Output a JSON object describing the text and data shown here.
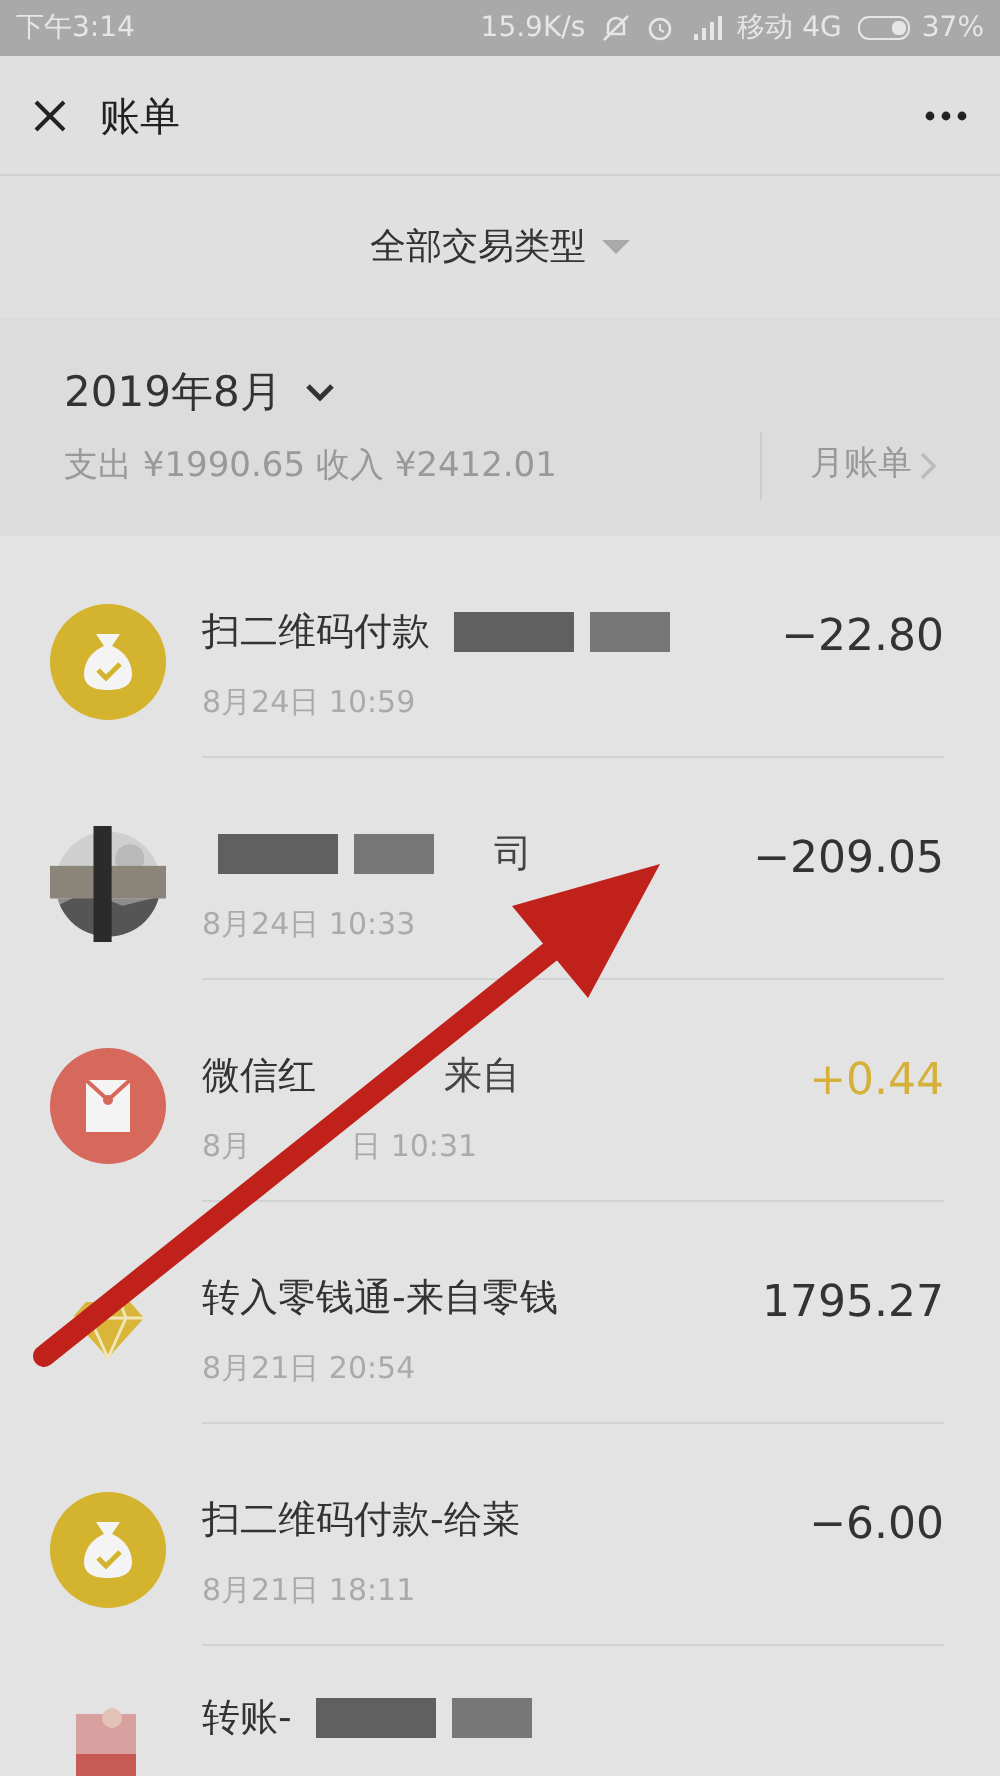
{
  "status_bar": {
    "time": "下午3:14",
    "speed": "15.9K/s",
    "carrier": "移动 4G",
    "battery": "37%"
  },
  "header": {
    "title": "账单"
  },
  "filter": {
    "label": "全部交易类型"
  },
  "month": {
    "title": "2019年8月",
    "summary": "支出 ¥1990.65 收入 ¥2412.01",
    "link": "月账单"
  },
  "transactions": [
    {
      "kind": "bag",
      "title": "扫二维码付款",
      "redacted": true,
      "date": [
        "8月24日 10:59"
      ],
      "amount": "−22.80",
      "income": false
    },
    {
      "title_end": "司",
      "redacted": true,
      "date": [
        "8月24日 10:33"
      ],
      "amount": "−209.05",
      "income": false
    },
    {
      "kind": "envelope",
      "title": "微信红",
      "title_end": "来自",
      "redacted": false,
      "date": [
        "8月",
        "日 10:31"
      ],
      "amount": "+0.44",
      "income": true
    },
    {
      "kind": "diamond",
      "title": "转入零钱通-来自零钱",
      "redacted": false,
      "date": [
        "8月21日 20:54"
      ],
      "amount": "1795.27",
      "income": false
    },
    {
      "kind": "bag",
      "title": "扫二维码付款-给菜",
      "redacted": false,
      "date": [
        "8月21日 18:11"
      ],
      "amount": "−6.00",
      "income": false
    },
    {
      "kind": "transfer",
      "title": "转账-",
      "redacted": true
    }
  ]
}
